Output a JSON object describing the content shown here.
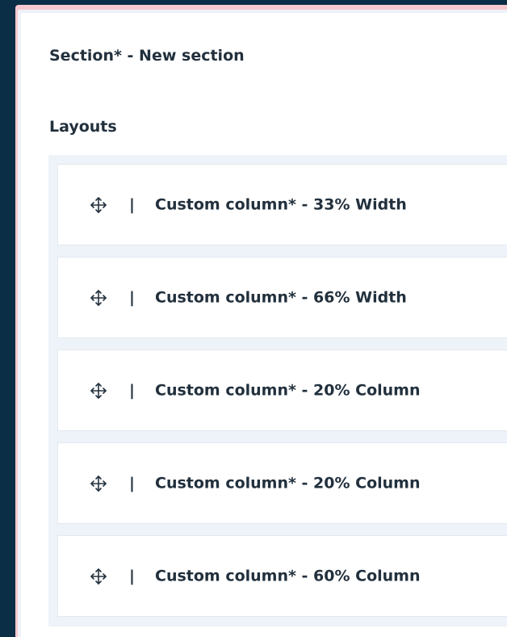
{
  "section": {
    "title": "Section* - New section"
  },
  "layouts": {
    "label": "Layouts",
    "separator": "|",
    "items": [
      {
        "label": "Custom column* - 33% Width",
        "icon": "move-icon"
      },
      {
        "label": "Custom column* - 66% Width",
        "icon": "move-icon"
      },
      {
        "label": "Custom column* - 20% Column",
        "icon": "move-icon"
      },
      {
        "label": "Custom column* - 20% Column",
        "icon": "move-icon"
      },
      {
        "label": "Custom column* - 60% Column",
        "icon": "move-icon"
      }
    ]
  },
  "colors": {
    "background": "#0a2e45",
    "frame_accent": "#f6c9cf",
    "panel": "#ffffff",
    "list_bg": "#eef3f9",
    "text": "#22303d"
  }
}
